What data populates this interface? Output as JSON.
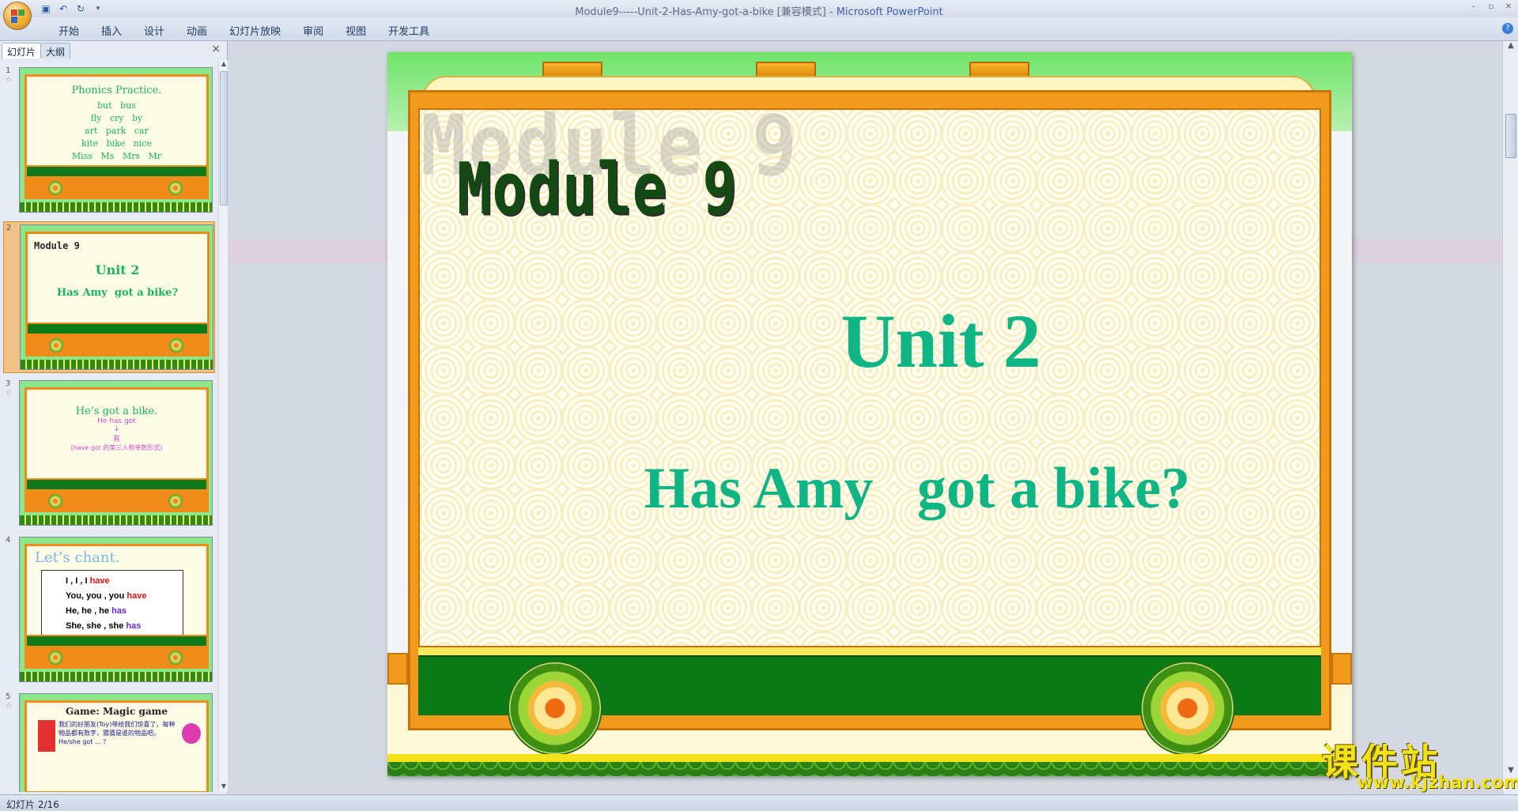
{
  "window": {
    "title": "Module9-----Unit-2-Has-Amy-got-a-bike [兼容模式]",
    "title_sep": " - ",
    "app_name": "Microsoft PowerPoint"
  },
  "ribbon": {
    "tabs": [
      "开始",
      "插入",
      "设计",
      "动画",
      "幻灯片放映",
      "审阅",
      "视图",
      "开发工具"
    ]
  },
  "pane": {
    "tabs": [
      "幻灯片",
      "大纲"
    ],
    "close": "×"
  },
  "thumbnails": [
    {
      "num": "1",
      "title": "Phonics Practice.",
      "lines": [
        "but   bus",
        "fly   cry   by",
        "art   park   car",
        "kite   bike   nice",
        "Miss   Ms   Mrs   Mr"
      ]
    },
    {
      "num": "2",
      "module": "Module 9",
      "unit": "Unit 2",
      "question": "Has Amy  got a bike?"
    },
    {
      "num": "3",
      "title": "He’s got a bike.",
      "sub1": "He has got",
      "sub2": "↓",
      "sub3": "有",
      "sub4": "(have got 的第三人称单数形式)"
    },
    {
      "num": "4",
      "title": "Let’s chant.",
      "rows": [
        {
          "a": "I , I , I ",
          "b": "have"
        },
        {
          "a": "You, you , you ",
          "b": "have"
        },
        {
          "a": "He, he , he ",
          "b": "has"
        },
        {
          "a": "She, she , she ",
          "b": "has"
        }
      ]
    },
    {
      "num": "5",
      "title": "Game: Magic game",
      "body": "我们的好朋友(Toy)带给我们惊喜了，每种物品都有数字，猜猜是谁的物品吧。He/she got ... ？"
    }
  ],
  "slide": {
    "module_title": "Module 9",
    "unit": "Unit 2",
    "question": "Has Amy   got a bike?"
  },
  "watermark": {
    "chinese": "课件站",
    "url": "www.kjzhan.com"
  },
  "status": {
    "slide_label": "幻灯片 2/16"
  },
  "colors": {
    "slide_text": "#10b585",
    "module_text": "#134a14",
    "train_frame": "#f29a1c",
    "train_base": "#0a7a16"
  }
}
